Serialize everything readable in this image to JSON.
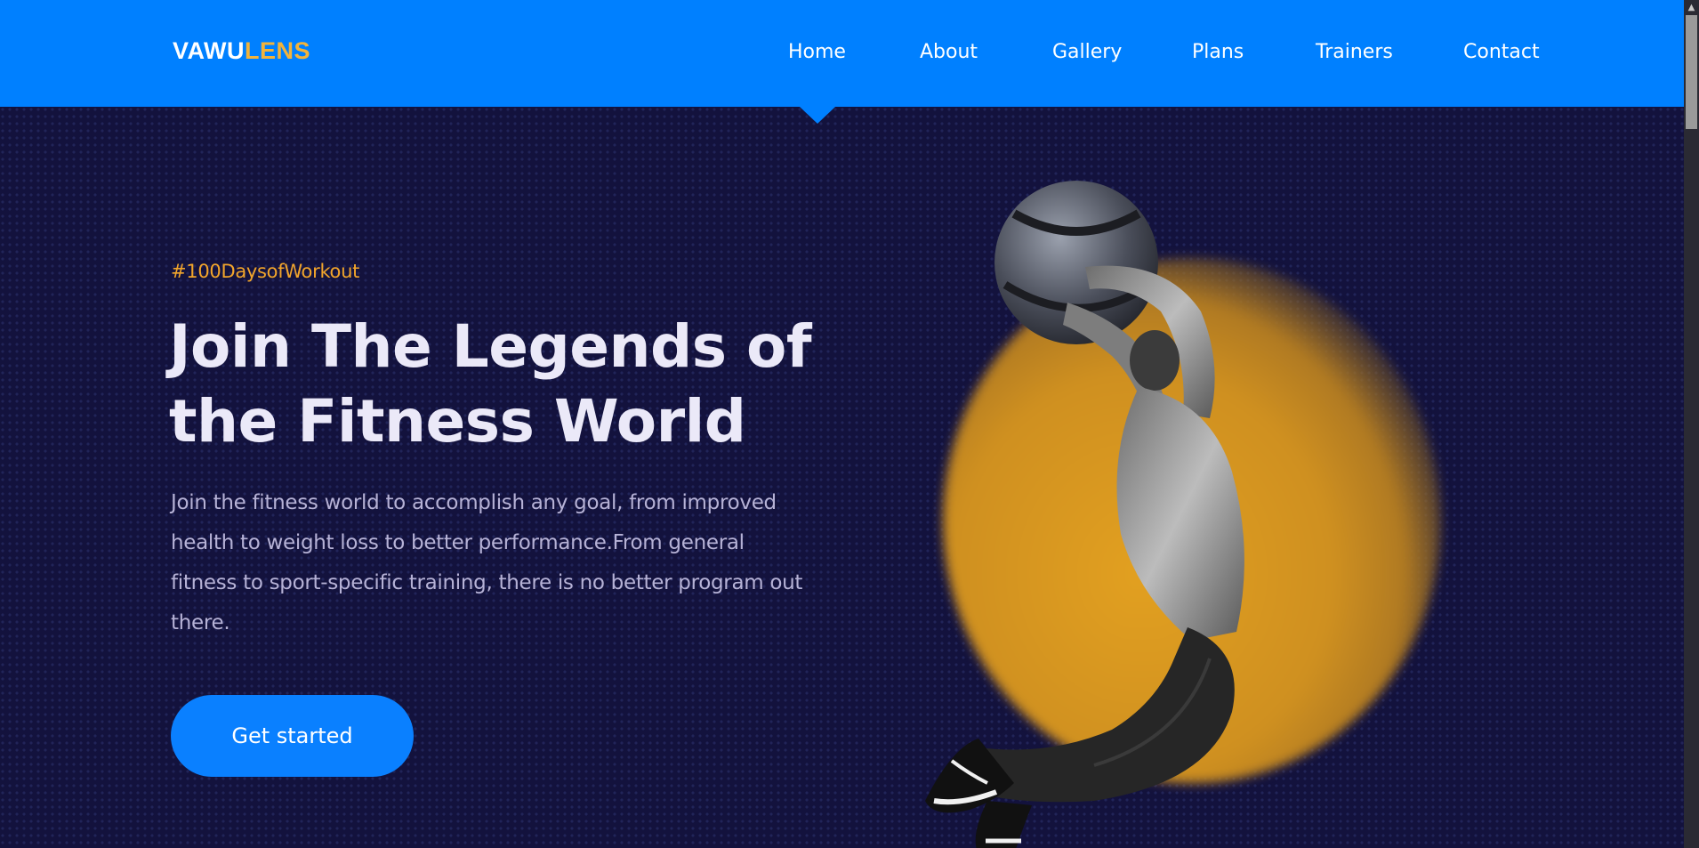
{
  "brand": {
    "prefix": "VAWU",
    "suffix": "LENS"
  },
  "nav": {
    "items": [
      {
        "label": "Home"
      },
      {
        "label": "About"
      },
      {
        "label": "Gallery"
      },
      {
        "label": "Plans"
      },
      {
        "label": "Trainers"
      },
      {
        "label": "Contact"
      }
    ],
    "active": "Home"
  },
  "hero": {
    "tag": "#100DaysofWorkout",
    "headline_line1": "Join The Legends of",
    "headline_line2": "the Fitness World",
    "description": "Join the fitness world to accomplish any goal, from improved health to weight loss to better performance.From general fitness to sport-specific training, there is no better program out there.",
    "cta_label": "Get started"
  },
  "colors": {
    "header": "#0080ff",
    "background": "#13123d",
    "accent": "#f2a52b",
    "button": "#0a80ff",
    "glow": "#e2a020"
  },
  "icons": {
    "scroll_up": "scroll-up-arrow-icon"
  }
}
